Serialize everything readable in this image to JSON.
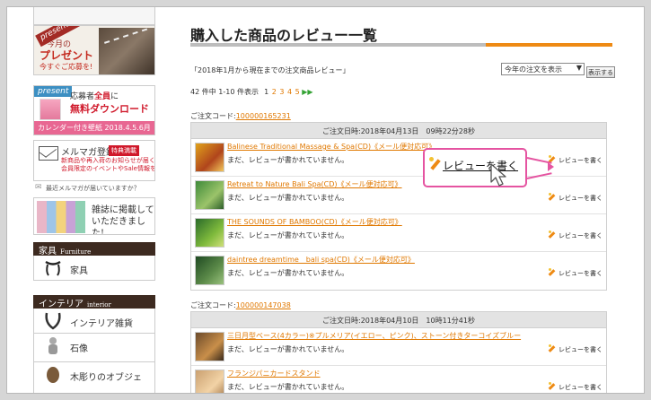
{
  "sidebar": {
    "banner_present": {
      "tag": "present",
      "line1": "今月の",
      "line2": "プレゼント",
      "line3": "今すぐご応募を!"
    },
    "banner_download": {
      "tag": "present",
      "line1a": "応募者",
      "line1b": "全員",
      "line1c": "に",
      "line2": "無料ダウンロード",
      "strip": "カレンダー付き壁紙  2018.4.5.6月"
    },
    "banner_mailmag": {
      "title": "メルマガ登録",
      "badge": "特典満載",
      "line1": "新商品や再入荷のお知らせが届く!",
      "line2": "会員限定のイベントやSale情報をお届け"
    },
    "mail_note": "最近メルマガが届いていますか？",
    "banner_magazine": {
      "line1": "雑誌に掲載して",
      "line2": "いただきました!"
    },
    "categories": [
      {
        "heading": "家具",
        "sub": "Furniture",
        "items": [
          {
            "label": "家具",
            "icon": "stool-icon"
          }
        ]
      },
      {
        "heading": "インテリア",
        "sub": "interior",
        "items": [
          {
            "label": "インテリア雑貨",
            "icon": "horn-icon"
          },
          {
            "label": "石像",
            "icon": "statue-icon"
          },
          {
            "label": "木彫りのオブジェ",
            "icon": "carving-icon"
          }
        ]
      }
    ]
  },
  "main": {
    "title": "購入した商品のレビュー一覧",
    "period": "「2018年1月から現在までの注文商品レビュー」",
    "period_select": "今年の注文を表示",
    "show_button": "表示する",
    "pager": {
      "summary": "42 件中 1-10 件表示",
      "pages": [
        "1",
        "2",
        "3",
        "4",
        "5"
      ],
      "next": "▶▶"
    },
    "orders": [
      {
        "code_label": "ご注文コード:",
        "code": "100000165231",
        "date": "ご注文日時:2018年04月13日　09時22分28秒",
        "items": [
          {
            "name": "Balinese Traditional Massage & Spa(CD)《メール便対応可》",
            "status": "まだ、レビューが書かれていません。",
            "action": "レビューを書く"
          },
          {
            "name": "Retreat to Nature Bali Spa(CD)《メール便対応可》",
            "status": "まだ、レビューが書かれていません。",
            "action": "レビューを書く"
          },
          {
            "name": "THE SOUNDS OF BAMBOO(CD)《メール便対応可》",
            "status": "まだ、レビューが書かれていません。",
            "action": "レビューを書く"
          },
          {
            "name": "daintree dreamtime　bali spa(CD)《メール便対応可》",
            "status": "まだ、レビューが書かれていません。",
            "action": "レビューを書く"
          }
        ]
      },
      {
        "code_label": "ご注文コード:",
        "code": "100000147038",
        "date": "ご注文日時:2018年04月10日　10時11分41秒",
        "items": [
          {
            "name": "三日月型ベース(4カラー)※プルメリア(イエロー、ピンク)、ストーン付きターコイズブルー",
            "status": "まだ、レビューが書かれていません。",
            "action": "レビューを書く"
          },
          {
            "name": "フランジパニカードスタンド",
            "status": "まだ、レビューが書かれていません。",
            "action": "レビューを書く"
          }
        ]
      }
    ],
    "callout": "レビューを書く"
  }
}
